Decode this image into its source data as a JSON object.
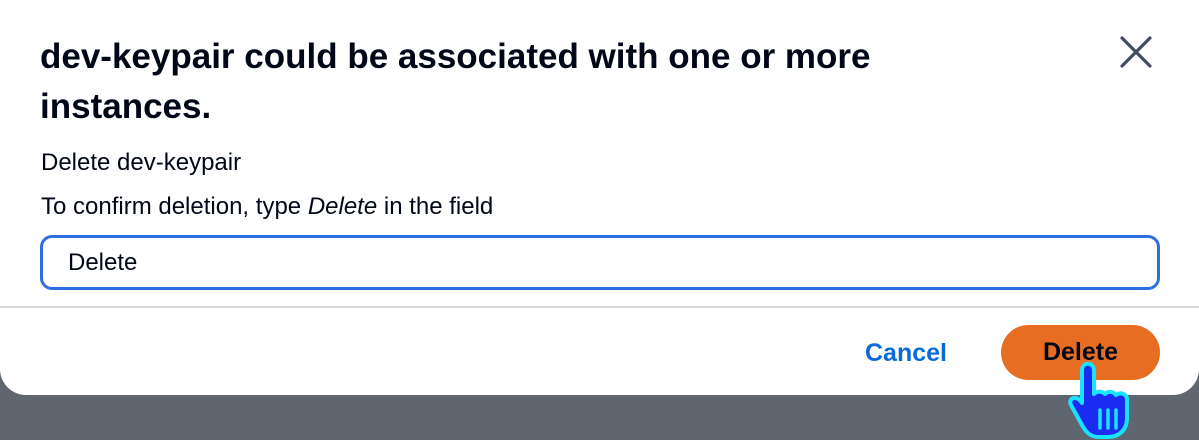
{
  "dialog": {
    "title": "dev-keypair could be associated with one or more instances.",
    "subtitle": "Delete dev-keypair",
    "instruction_prefix": "To confirm deletion, type ",
    "instruction_keyword": "Delete",
    "instruction_suffix": " in the field",
    "input_value": "Delete",
    "close_icon": "close-icon",
    "cancel_label": "Cancel",
    "delete_label": "Delete"
  },
  "cursor": {
    "icon": "hand-pointer-icon"
  },
  "colors": {
    "primary_button": "#e76d23",
    "link_button": "#0a6bd6",
    "input_focus_border": "#2d6fe0",
    "overlay": "#5f6670",
    "cursor_fill": "#1b2cf0",
    "cursor_outline": "#18e4ff"
  }
}
